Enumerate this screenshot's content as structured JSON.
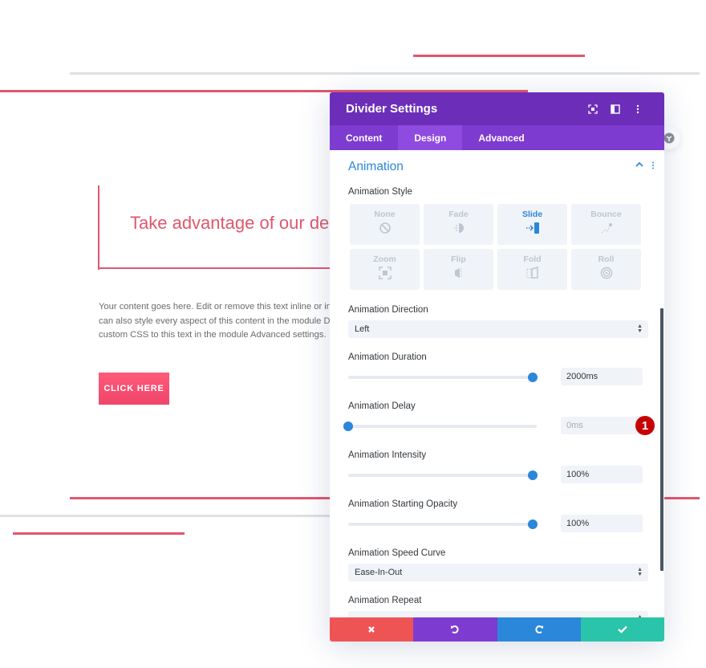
{
  "page": {
    "headline": "Take advantage of our de",
    "body_lines": [
      "Your content goes here. Edit or remove this text inline or in",
      "can also style every aspect of this content in the module De",
      "custom CSS to this text in the module Advanced settings."
    ],
    "cta_label": "CLICK HERE",
    "accent_color": "#e0576f"
  },
  "panel": {
    "title": "Divider Settings",
    "header_icons": [
      "focus-icon",
      "split-view-icon",
      "more-vertical-icon"
    ],
    "tabs": [
      {
        "label": "Content",
        "active": false
      },
      {
        "label": "Design",
        "active": true
      },
      {
        "label": "Advanced",
        "active": false
      }
    ],
    "section": {
      "title": "Animation",
      "expanded": true
    },
    "animation_style": {
      "label": "Animation Style",
      "options": [
        {
          "label": "None",
          "icon": "none-icon",
          "active": false
        },
        {
          "label": "Fade",
          "icon": "fade-icon",
          "active": false
        },
        {
          "label": "Slide",
          "icon": "slide-icon",
          "active": true
        },
        {
          "label": "Bounce",
          "icon": "bounce-icon",
          "active": false
        },
        {
          "label": "Zoom",
          "icon": "zoom-icon",
          "active": false
        },
        {
          "label": "Flip",
          "icon": "flip-icon",
          "active": false
        },
        {
          "label": "Fold",
          "icon": "fold-icon",
          "active": false
        },
        {
          "label": "Roll",
          "icon": "roll-icon",
          "active": false
        }
      ]
    },
    "direction": {
      "label": "Animation Direction",
      "value": "Left"
    },
    "duration": {
      "label": "Animation Duration",
      "value": "2000ms",
      "slider_fraction": 0.98
    },
    "delay": {
      "label": "Animation Delay",
      "value": "0ms",
      "slider_fraction": 0.0,
      "annotation": "1"
    },
    "intensity": {
      "label": "Animation Intensity",
      "value": "100%",
      "slider_fraction": 0.98
    },
    "starting_opacity": {
      "label": "Animation Starting Opacity",
      "value": "100%",
      "slider_fraction": 0.98
    },
    "speed_curve": {
      "label": "Animation Speed Curve",
      "value": "Ease-In-Out"
    },
    "repeat": {
      "label": "Animation Repeat",
      "value": ""
    },
    "footer": {
      "cancel_color": "#ef5455",
      "undo_color": "#7e3bd0",
      "redo_color": "#2b87da",
      "save_color": "#29c4a9"
    }
  }
}
